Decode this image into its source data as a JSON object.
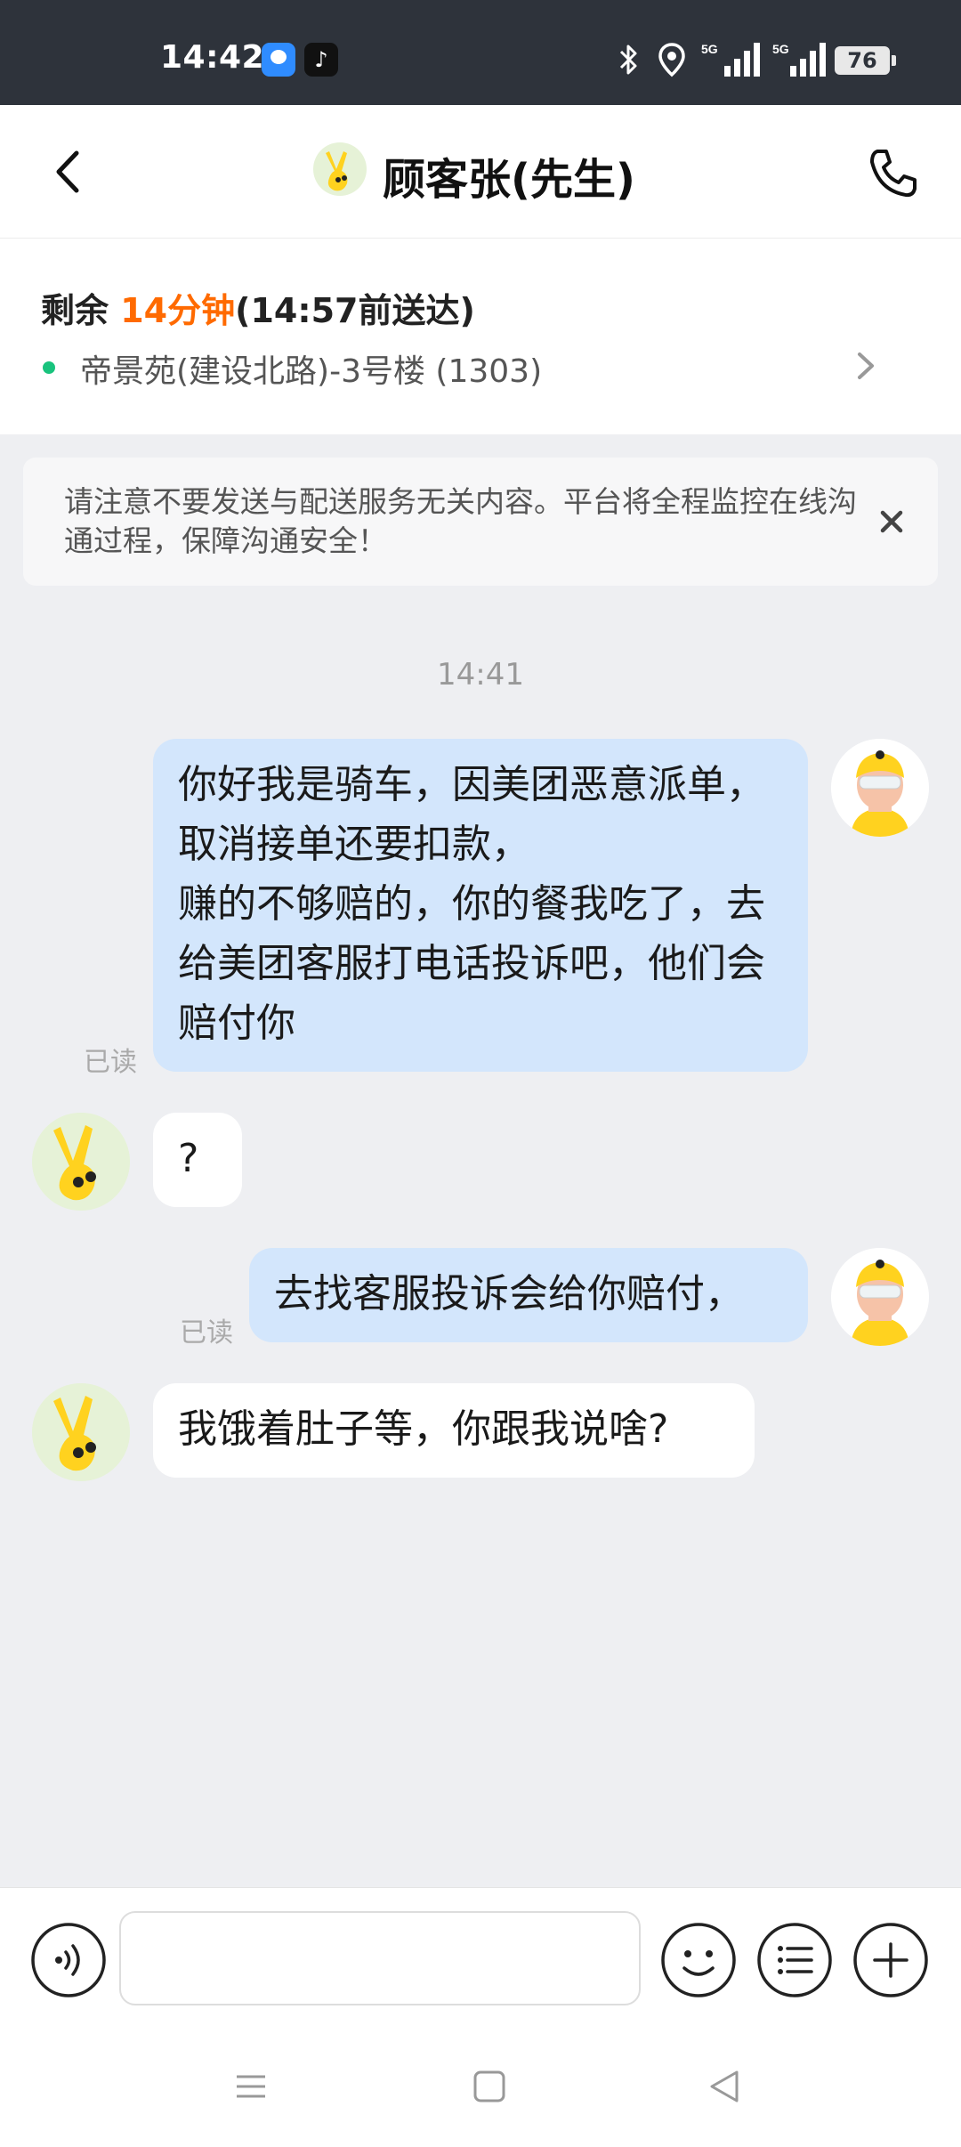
{
  "status_bar": {
    "time": "14:42",
    "battery": "76",
    "network": "5G",
    "icons": [
      "app-icon",
      "tiktok-icon",
      "bluetooth-icon",
      "location-icon",
      "signal-icon",
      "signal-icon",
      "battery-icon"
    ]
  },
  "header": {
    "title": "顾客张(先生)",
    "back_icon": "back-arrow-icon",
    "phone_icon": "phone-icon"
  },
  "order": {
    "remaining_prefix": "剩余 ",
    "remaining_time": "14分钟",
    "deliver_by": "(14:57前送达)",
    "address": "帝景苑(建设北路)-3号楼 (1303)"
  },
  "notice": {
    "text": "请注意不要发送与配送服务无关内容。平台将全程监控在线沟通过程，保障沟通安全！"
  },
  "chat": {
    "timestamp": "14:41",
    "messages": [
      {
        "from": "rider",
        "text": "你好我是骑车，因美团恶意派单，取消接单还要扣款，\n赚的不够赔的，你的餐我吃了，去给美团客服打电话投诉吧，他们会赔付你",
        "status": "已读"
      },
      {
        "from": "customer",
        "text": "?"
      },
      {
        "from": "rider",
        "text": "去找客服投诉会给你赔付，",
        "status": "已读"
      },
      {
        "from": "customer",
        "text": "我饿着肚子等，你跟我说啥?"
      }
    ]
  },
  "input_bar": {
    "placeholder": "",
    "icons": [
      "voice-icon",
      "emoji-icon",
      "quick-reply-icon",
      "plus-icon"
    ]
  },
  "colors": {
    "accent_orange": "#ff6a00",
    "mine_bubble": "#d3e6fc",
    "status_green": "#19c37d",
    "status_bar_bg": "#2e333b"
  }
}
